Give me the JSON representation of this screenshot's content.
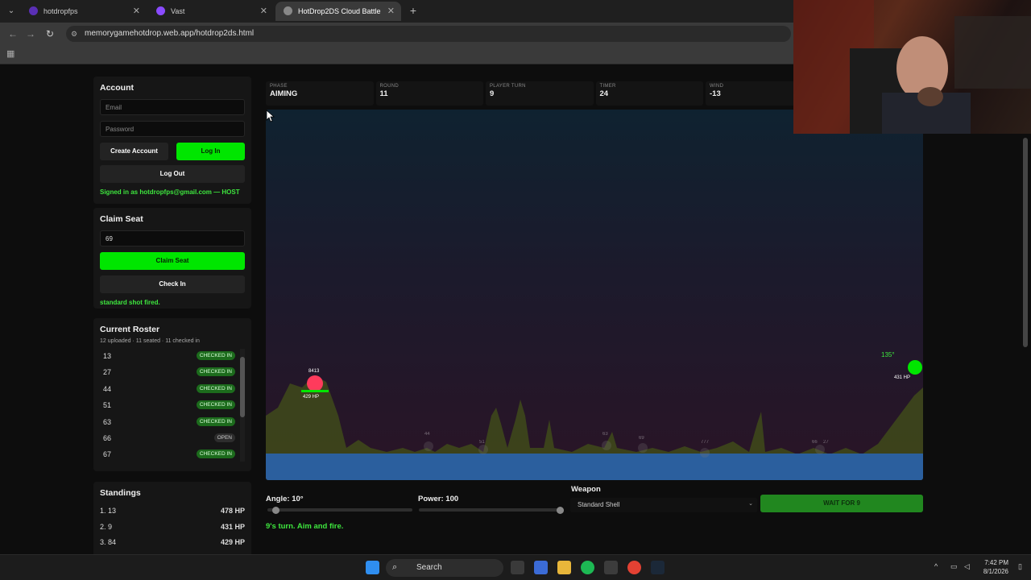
{
  "browser": {
    "tabs": [
      {
        "title": "hotdropfps",
        "favicon_color": "#5a2fb5"
      },
      {
        "title": "Vast",
        "favicon_color": "#8a4bff"
      },
      {
        "title": "HotDrop2DS Cloud Battle",
        "favicon_color": "#888888"
      }
    ],
    "url": "memorygamehotdrop.web.app/hotdrop2ds.html"
  },
  "account": {
    "title": "Account",
    "email_placeholder": "Email",
    "password_placeholder": "Password",
    "create_label": "Create Account",
    "login_label": "Log In",
    "logout_label": "Log Out",
    "signed_in_text": "Signed in as hotdropfps@gmail.com — HOST"
  },
  "claim": {
    "title": "Claim Seat",
    "seat_value": "69",
    "claim_label": "Claim Seat",
    "checkin_label": "Check In",
    "status_text": "standard shot fired."
  },
  "roster": {
    "title": "Current Roster",
    "summary": "12 uploaded · 11 seated · 11 checked in",
    "rows": [
      {
        "num": "13",
        "status": "CHECKED IN"
      },
      {
        "num": "27",
        "status": "CHECKED IN"
      },
      {
        "num": "44",
        "status": "CHECKED IN"
      },
      {
        "num": "51",
        "status": "CHECKED IN"
      },
      {
        "num": "63",
        "status": "CHECKED IN"
      },
      {
        "num": "66",
        "status": "OPEN"
      },
      {
        "num": "67",
        "status": "CHECKED IN"
      }
    ]
  },
  "standings": {
    "title": "Standings",
    "rows": [
      {
        "name": "1. 13",
        "hp": "478 HP"
      },
      {
        "name": "2. 9",
        "hp": "431 HP"
      },
      {
        "name": "3. 84",
        "hp": "429 HP"
      }
    ]
  },
  "stats": [
    {
      "label": "PHASE",
      "value": "AIMING"
    },
    {
      "label": "ROUND",
      "value": "11"
    },
    {
      "label": "PLAYER TURN",
      "value": "9"
    },
    {
      "label": "TIMER",
      "value": "24"
    },
    {
      "label": "WIND",
      "value": "-13"
    },
    {
      "label": "",
      "value": ""
    }
  ],
  "battlefield": {
    "left_tank_id": "8413",
    "left_tank_hp": "429 HP",
    "right_tank_angle": "135°",
    "right_tank_hp": "431 HP",
    "faded_tanks": [
      "44",
      "51",
      "63",
      "69",
      "777",
      "66",
      "27"
    ]
  },
  "controls": {
    "angle_label": "Angle: 10°",
    "power_label": "Power: 100",
    "weapon_label": "Weapon",
    "weapon_selected": "Standard Shell",
    "fire_label": "WAIT FOR 9",
    "turn_message": "9's turn. Aim and fire.",
    "angle_value": 10,
    "power_value": 100
  },
  "taskbar": {
    "search_label": "Search",
    "time": "7:42 PM",
    "date": "8/1/2026"
  }
}
